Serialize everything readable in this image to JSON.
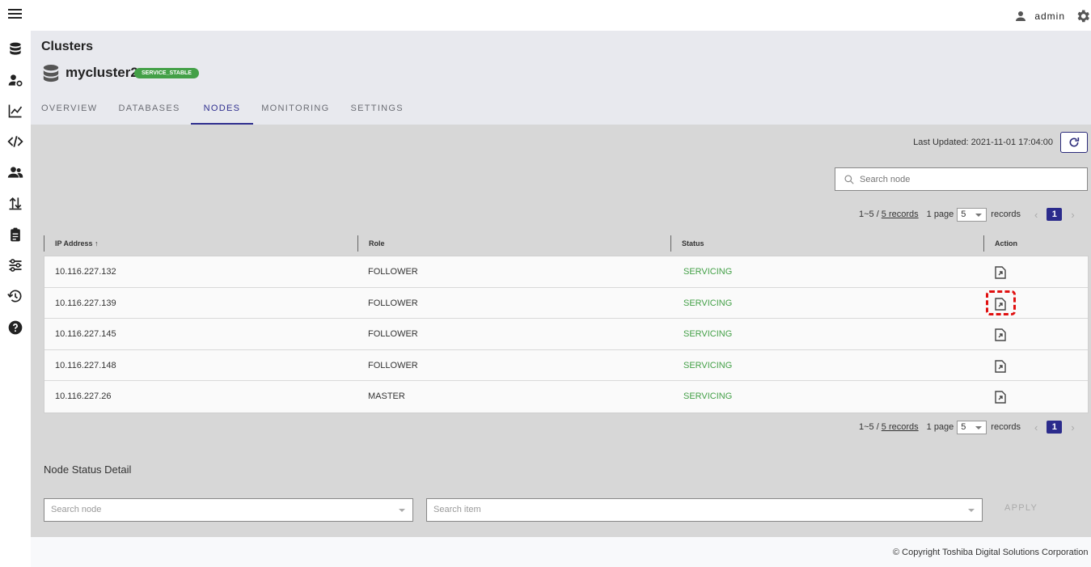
{
  "topbar": {
    "username": "admin"
  },
  "sidebar": {
    "items": [
      {
        "icon": "database-icon"
      },
      {
        "icon": "user-settings-icon"
      },
      {
        "icon": "chart-line-icon"
      },
      {
        "icon": "code-icon"
      },
      {
        "icon": "users-icon"
      },
      {
        "icon": "import-export-icon"
      },
      {
        "icon": "clipboard-icon"
      },
      {
        "icon": "settings-sliders-icon"
      },
      {
        "icon": "restore-icon"
      },
      {
        "icon": "help-icon"
      }
    ]
  },
  "header": {
    "breadcrumb": "Clusters",
    "cluster_name": "mycluster2",
    "badge": "SERVICE_STABLE",
    "tabs": [
      {
        "label": "OVERVIEW"
      },
      {
        "label": "DATABASES"
      },
      {
        "label": "NODES"
      },
      {
        "label": "MONITORING"
      },
      {
        "label": "SETTINGS"
      }
    ],
    "active_tab": "NODES"
  },
  "nodes": {
    "last_updated": "Last Updated: 2021-11-01 17:04:00",
    "search_placeholder": "Search node",
    "pagination": {
      "range": "1~5 /",
      "records_link": "5 records",
      "per_page_label": "1 page",
      "per_page_value": "5",
      "records_label": "records",
      "current_page": "1",
      "prev": "‹",
      "next": "›"
    },
    "columns": [
      "IP Address",
      "Role",
      "Status",
      "Action"
    ],
    "rows": [
      {
        "ip": "10.116.227.132",
        "role": "FOLLOWER",
        "status": "SERVICING"
      },
      {
        "ip": "10.116.227.139",
        "role": "FOLLOWER",
        "status": "SERVICING"
      },
      {
        "ip": "10.116.227.145",
        "role": "FOLLOWER",
        "status": "SERVICING"
      },
      {
        "ip": "10.116.227.148",
        "role": "FOLLOWER",
        "status": "SERVICING"
      },
      {
        "ip": "10.116.227.26",
        "role": "MASTER",
        "status": "SERVICING"
      }
    ]
  },
  "detail": {
    "title": "Node Status Detail",
    "node_placeholder": "Search node",
    "item_placeholder": "Search item",
    "apply_label": "APPLY"
  },
  "footer": {
    "copyright": "© Copyright Toshiba Digital Solutions Corporation"
  },
  "colors": {
    "accent": "#2b2b8c",
    "status_ok": "#43a047",
    "highlight": "#e01010"
  }
}
